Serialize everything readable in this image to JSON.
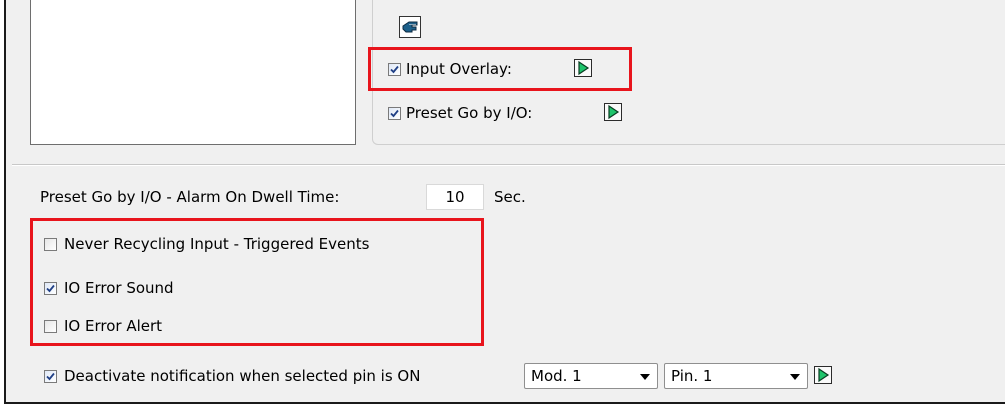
{
  "top_group": {
    "input_overlay": {
      "label": "Input Overlay:",
      "checked": true
    },
    "preset_go_io": {
      "label": "Preset Go by I/O:",
      "checked": true
    }
  },
  "dwell": {
    "label": "Preset Go by I/O - Alarm On Dwell Time:",
    "value": "10",
    "unit": "Sec."
  },
  "options": {
    "never_recycling": {
      "label": "Never Recycling Input - Triggered Events",
      "checked": false
    },
    "io_error_sound": {
      "label": "IO Error Sound",
      "checked": true
    },
    "io_error_alert": {
      "label": "IO Error Alert",
      "checked": false
    },
    "deactivate_notification": {
      "label": "Deactivate notification when selected pin is ON",
      "checked": true
    }
  },
  "selects": {
    "module": {
      "value": "Mod. 1"
    },
    "pin": {
      "value": "Pin. 1"
    }
  },
  "icons": {
    "hand": "pointing-hand-icon",
    "play": "green-play-arrow-icon"
  },
  "colors": {
    "highlight": "#e8141c",
    "panel_bg": "#f0f0f0",
    "play_fill": "#1ec46b",
    "check_mark": "#1f3f86"
  }
}
